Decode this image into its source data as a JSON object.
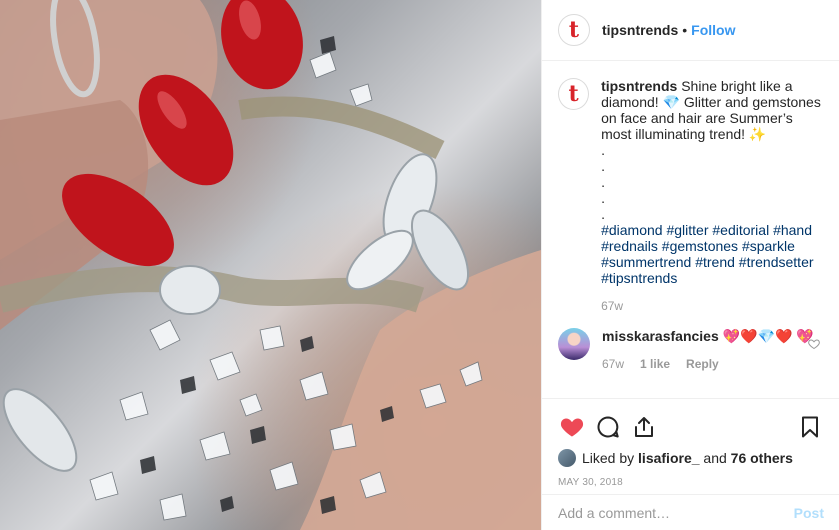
{
  "header": {
    "avatar_letter": "t",
    "username": "tipsntrends",
    "separator": "•",
    "follow_label": "Follow"
  },
  "caption": {
    "username": "tipsntrends",
    "line1": "Shine bright like a diamond! 💎 Glitter and gemstones on face and hair are Summer’s most illuminating trend! ✨",
    "dots": [
      ".",
      ".",
      ".",
      ".",
      "."
    ],
    "hashtags": "#diamond #glitter #editorial #hand #rednails #gemstones #sparkle #summertrend #trend #trendsetter #tipsntrends",
    "time": "67w"
  },
  "comment": {
    "username": "misskarasfancies",
    "text": "💖❤️💎❤️ 💖",
    "time": "67w",
    "likes": "1 like",
    "reply_label": "Reply"
  },
  "likes": {
    "prefix": "Liked by",
    "user": "lisafiore_",
    "middle": "and",
    "others": "76 others"
  },
  "date": "MAY 30, 2018",
  "add_comment": {
    "placeholder": "Add a comment…",
    "post_label": "Post"
  },
  "colors": {
    "link_blue": "#3897f0",
    "hashtag_blue": "#003569",
    "heart_red": "#ed4956",
    "brand_red": "#d8232a"
  },
  "icons": [
    "heart-icon",
    "comment-icon",
    "share-icon",
    "bookmark-icon"
  ]
}
